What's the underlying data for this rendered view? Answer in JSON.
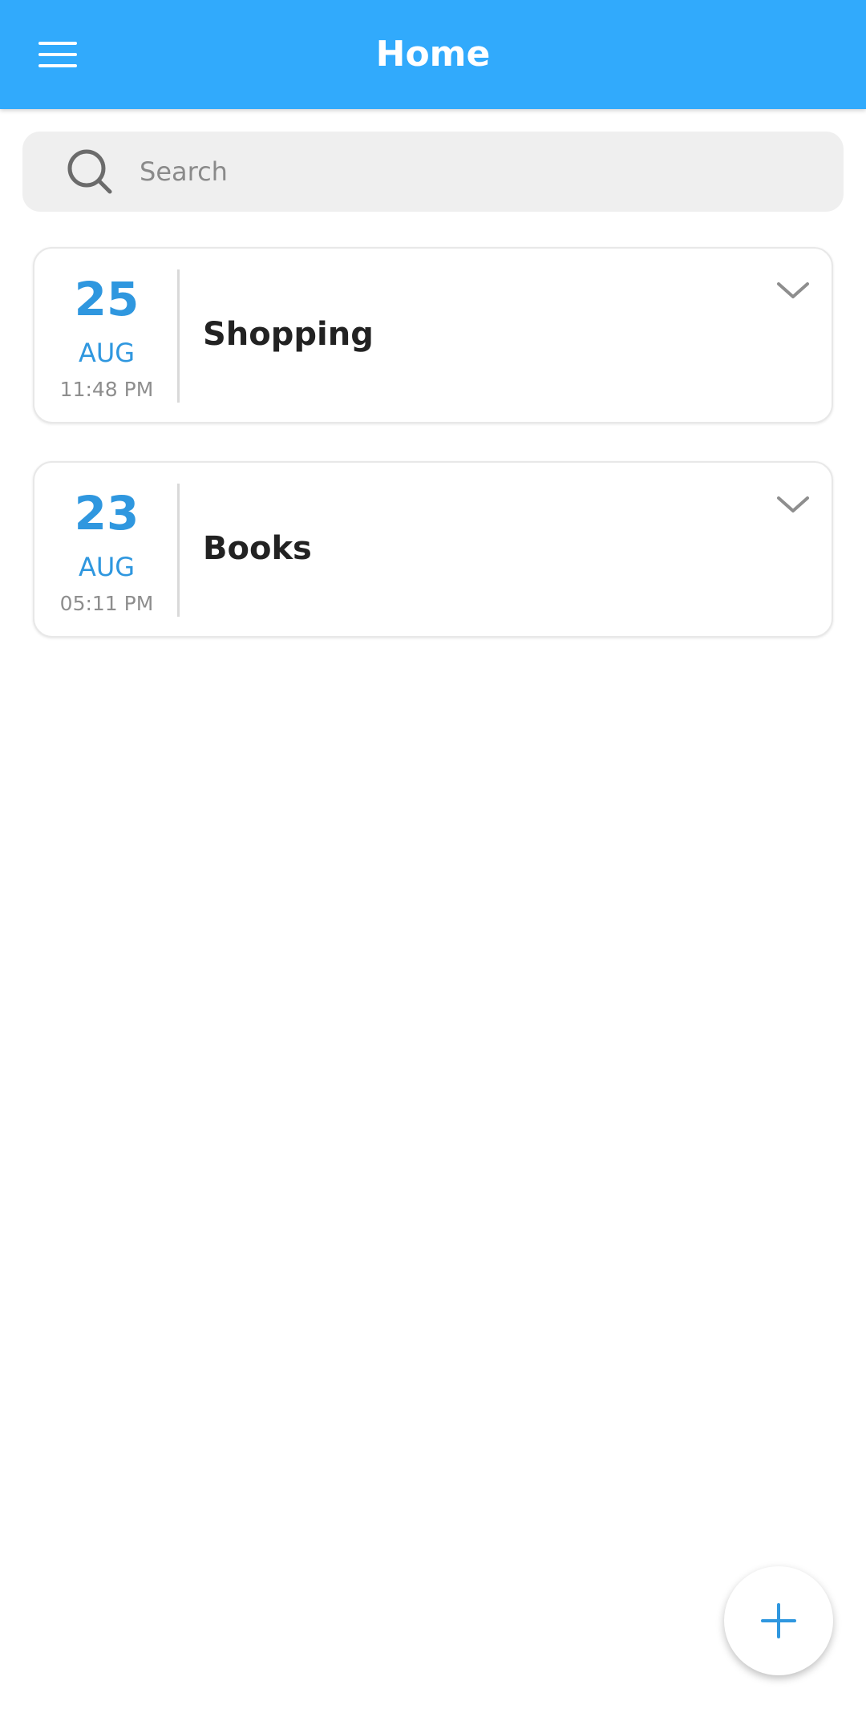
{
  "header": {
    "title": "Home",
    "menu_icon": "menu-icon",
    "background_color": "#31aafc"
  },
  "search": {
    "placeholder": "Search",
    "value": "",
    "icon": "search-icon"
  },
  "notes": [
    {
      "day": "25",
      "month": "AUG",
      "time": "11:48 PM",
      "title": "Shopping",
      "expand_icon": "chevron-down-icon"
    },
    {
      "day": "23",
      "month": "AUG",
      "time": "05:11 PM",
      "title": "Books",
      "expand_icon": "chevron-down-icon"
    }
  ],
  "fab": {
    "icon": "plus-icon"
  },
  "colors": {
    "accent": "#2f97df",
    "title_text": "#222222",
    "muted_text": "#8e8e8e"
  }
}
